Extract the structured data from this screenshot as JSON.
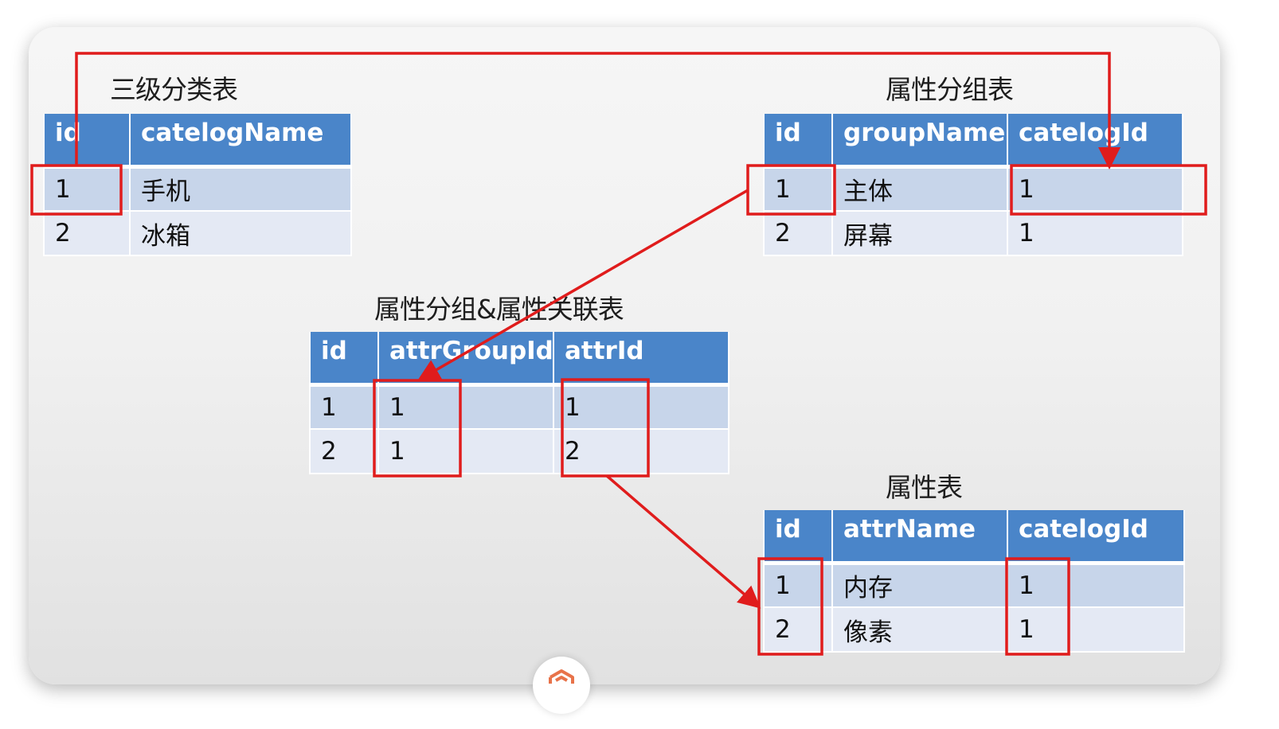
{
  "tables": {
    "category": {
      "title": "三级分类表",
      "columns": [
        "id",
        "catelogName"
      ],
      "rows": [
        [
          "1",
          "手机"
        ],
        [
          "2",
          "冰箱"
        ]
      ]
    },
    "attr_group": {
      "title": "属性分组表",
      "columns": [
        "id",
        "groupName",
        "catelogId"
      ],
      "rows": [
        [
          "1",
          "主体",
          "1"
        ],
        [
          "2",
          "屏幕",
          "1"
        ]
      ]
    },
    "relation": {
      "title": "属性分组&属性关联表",
      "columns": [
        "id",
        "attrGroupId",
        "attrId"
      ],
      "rows": [
        [
          "1",
          "1",
          "1"
        ],
        [
          "2",
          "1",
          "2"
        ]
      ]
    },
    "attr": {
      "title": "属性表",
      "columns": [
        "id",
        "attrName",
        "catelogId"
      ],
      "rows": [
        [
          "1",
          "内存",
          "1"
        ],
        [
          "2",
          "像素",
          "1"
        ]
      ]
    }
  },
  "colors": {
    "header": "#4a85c9",
    "row_dark": "#c7d5ea",
    "row_light": "#e4e9f4",
    "highlight": "#e01c1c"
  },
  "logo_icon": "brand-logo-icon"
}
